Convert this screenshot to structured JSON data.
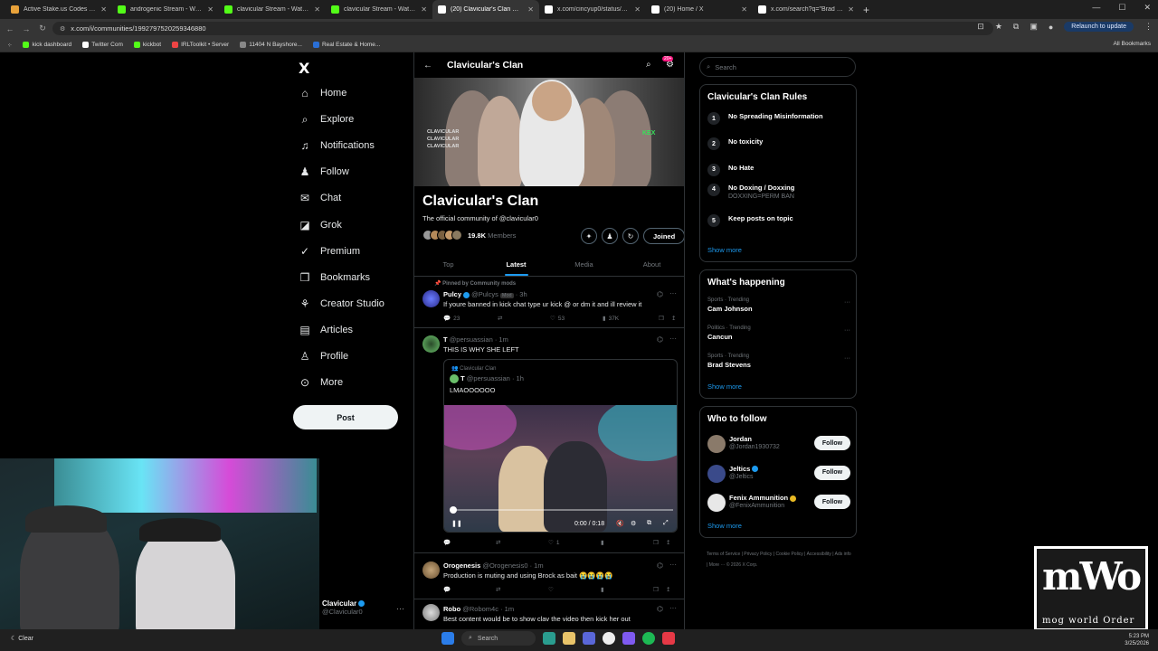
{
  "browser": {
    "tabs": [
      {
        "title": "Active Stake.us Codes (Updated",
        "color": "#e8a23a",
        "icon": "stake-favicon-icon"
      },
      {
        "title": "androgenic Stream - Watch Live",
        "color": "#53fc18",
        "icon": "kick-favicon-icon"
      },
      {
        "title": "clavicular Stream - Watch Live",
        "color": "#53fc18",
        "icon": "kick-favicon-icon"
      },
      {
        "title": "clavicular Stream - Watch Live",
        "color": "#53fc18",
        "icon": "kick-favicon-icon"
      },
      {
        "title": "(20) Clavicular's Clan Communi",
        "color": "#ffffff",
        "icon": "x-favicon-icon"
      },
      {
        "title": "x.com/cincyup0/status/203868",
        "color": "#ffffff",
        "icon": "x-favicon-icon"
      },
      {
        "title": "(20) Home / X",
        "color": "#ffffff",
        "icon": "x-favicon-icon"
      },
      {
        "title": "x.com/search?q=\"Brad Stevens",
        "color": "#ffffff",
        "icon": "x-favicon-icon"
      }
    ],
    "active_tab": 4,
    "url": "x.com/i/communities/1992797520259346880",
    "relaunch": "Relaunch to update",
    "bookmarks": [
      {
        "label": "kick dashboard",
        "color": "#53fc18"
      },
      {
        "label": "Twitter Com",
        "color": "#ffffff"
      },
      {
        "label": "kickbot",
        "color": "#53fc18"
      },
      {
        "label": "IRLToolkit • Server",
        "color": "#e44"
      },
      {
        "label": "11404 N Bayshore...",
        "color": "#888"
      },
      {
        "label": "Real Estate & Home...",
        "color": "#2a6fd6"
      }
    ],
    "all_bookmarks": "All Bookmarks"
  },
  "nav": {
    "logo": "X",
    "items": [
      {
        "label": "Home",
        "icon": "home-icon",
        "glyph": "⌂"
      },
      {
        "label": "Explore",
        "icon": "search-icon",
        "glyph": "⌕"
      },
      {
        "label": "Notifications",
        "icon": "bell-icon",
        "glyph": "♫"
      },
      {
        "label": "Follow",
        "icon": "person-add-icon",
        "glyph": "♟"
      },
      {
        "label": "Chat",
        "icon": "mail-icon",
        "glyph": "✉"
      },
      {
        "label": "Grok",
        "icon": "grok-icon",
        "glyph": "◪"
      },
      {
        "label": "Premium",
        "icon": "premium-icon",
        "glyph": "✓"
      },
      {
        "label": "Bookmarks",
        "icon": "bookmark-icon",
        "glyph": "❒"
      },
      {
        "label": "Creator Studio",
        "icon": "creator-studio-icon",
        "glyph": "⚘"
      },
      {
        "label": "Articles",
        "icon": "articles-icon",
        "glyph": "▤"
      },
      {
        "label": "Profile",
        "icon": "profile-icon",
        "glyph": "♙"
      },
      {
        "label": "More",
        "icon": "more-icon",
        "glyph": "⊙"
      }
    ],
    "post": "Post",
    "account": {
      "name": "Clavicular",
      "handle": "@Clavicular0"
    }
  },
  "community": {
    "header_title": "Clavicular's Clan",
    "badge": "20+",
    "banner_text": [
      "CLAVICULAR",
      "CLAVICULAR",
      "CLAVICULAR"
    ],
    "banner_mark": "KEX",
    "name": "Clavicular's Clan",
    "description": "The official community of @clavicular0",
    "member_count": "19.8K",
    "members_label": "Members",
    "joined": "Joined",
    "tabs": [
      "Top",
      "Latest",
      "Media",
      "About"
    ],
    "selected_tab": "Latest"
  },
  "posts": [
    {
      "pinned": "Pinned by Community mods",
      "name": "Pulcy",
      "handle": "@Pulcys",
      "tag": "Mod",
      "time": "· 3h",
      "text": "If youre banned in kick chat type ur kick @ or dm it and ill review it",
      "replies": "23",
      "likes": "53",
      "views": "37K"
    },
    {
      "name": "T",
      "handle": "@persuassian",
      "time": "· 1m",
      "text": "THIS IS WHY SHE LEFT",
      "quote": {
        "community": "Clavicular Clan",
        "name": "T",
        "handle": "@persuassian",
        "time": "· 1h",
        "text": "LMAOOOOOO",
        "video_time": "0:00 / 0:18"
      },
      "likes": "1"
    },
    {
      "name": "Orogenesis",
      "handle": "@Orogenesis0",
      "time": "· 1m",
      "text": "Production is muting and using Brock as bait 😭😭😭😭"
    },
    {
      "name": "Robo",
      "handle": "@Robom4c",
      "time": "· 1m",
      "text": "Best content would be to show clav the video then kick her out"
    }
  ],
  "sidebar": {
    "search_placeholder": "Search",
    "rules_title": "Clavicular's Clan Rules",
    "rules": [
      {
        "num": "1",
        "text": "No Spreading Misinformation",
        "sub": ""
      },
      {
        "num": "2",
        "text": "No toxicity",
        "sub": ""
      },
      {
        "num": "3",
        "text": "No Hate",
        "sub": ""
      },
      {
        "num": "4",
        "text": "No Doxing / Doxxing",
        "sub": "DOXXING=PERM BAN"
      },
      {
        "num": "5",
        "text": "Keep posts on topic",
        "sub": ""
      }
    ],
    "show_more": "Show more",
    "happening_title": "What's happening",
    "trends": [
      {
        "meta": "Sports · Trending",
        "name": "Cam Johnson"
      },
      {
        "meta": "Politics · Trending",
        "name": "Cancun"
      },
      {
        "meta": "Sports · Trending",
        "name": "Brad Stevens"
      }
    ],
    "wtf_title": "Who to follow",
    "follow": [
      {
        "name": "Jordan",
        "handle": "@Jordan1930732",
        "verified": false,
        "gold": false
      },
      {
        "name": "Jeltics",
        "handle": "@Jeltics",
        "verified": true,
        "gold": false
      },
      {
        "name": "Fenix Ammunition",
        "handle": "@FenixAmmunition",
        "verified": true,
        "gold": true
      }
    ],
    "follow_btn": "Follow",
    "footer": "Terms of Service  |  Privacy Policy  |  Cookie Policy  |  Accessibility  |  Ads info  |  More ···  © 2026 X Corp."
  },
  "overlay": {
    "logo_big": "mWo",
    "logo_small": "mog world Order"
  },
  "taskbar": {
    "weather": "Clear",
    "search": "Search",
    "time": "5:23 PM",
    "date": "3/25/2026"
  }
}
